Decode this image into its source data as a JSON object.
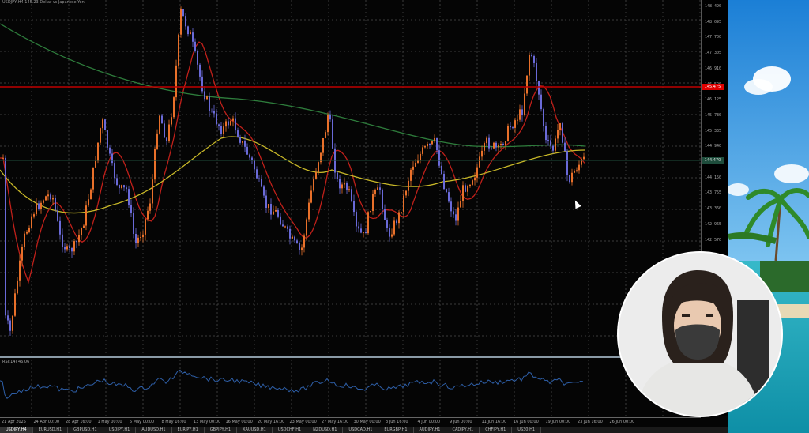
{
  "chart": {
    "title": "USDJPY,H4  145.23 Dollar vs Japanese Yen",
    "bid_price": "145.475",
    "ask_price": "144.470",
    "price_ticks": [
      "148.490",
      "148.095",
      "147.700",
      "147.305",
      "146.910",
      "146.520",
      "146.125",
      "145.730",
      "145.335",
      "144.940",
      "144.545",
      "144.150",
      "143.755",
      "143.360",
      "142.965",
      "142.570"
    ],
    "time_ticks": [
      "21 Apr 2025",
      "24 Apr 00:00",
      "28 Apr 16:00",
      "1 May 00:00",
      "5 May 00:00",
      "8 May 16:00",
      "13 May 00:00",
      "16 May 00:00",
      "20 May 16:00",
      "23 May 00:00",
      "27 May 16:00",
      "30 May 00:00",
      "3 Jun 16:00",
      "4 Jun 00:00",
      "9 Jun 00:00",
      "11 Jun 16:00",
      "16 Jun 00:00",
      "19 Jun 00:00",
      "23 Jun 16:00",
      "26 Jun 00:00"
    ],
    "indicator_label": "RSI(14) 46.06",
    "colors": {
      "grid": "#3c3c3c",
      "bull": "#e8702a",
      "bear": "#6a6ad8",
      "ma_fast": "#c0201a",
      "ma_mid": "#2e7d3c",
      "ma_slow": "#c8b828",
      "bid_line": "#c00000",
      "ask_line": "#1e4d3c",
      "rsi": "#2e5fa8"
    }
  },
  "symbol_tabs": [
    "USDJPY,H4",
    "EURUSD,H1",
    "GBPUSD,H1",
    "USDJPY,H1",
    "AUDUSD,H1",
    "EURJPY,H1",
    "GBPJPY,H1",
    "XAUUSD,H1",
    "USDCHF,H1",
    "NZDUSD,H1",
    "USDCAD,H1",
    "EURGBP,H1",
    "AUDJPY,H1",
    "CADJPY,H1",
    "CHFJPY,H1",
    "US30,H1"
  ],
  "active_tab_index": 0,
  "webcam": {
    "subject": "person-wearing-mask"
  },
  "background": {
    "scene": "tropical-beach"
  }
}
